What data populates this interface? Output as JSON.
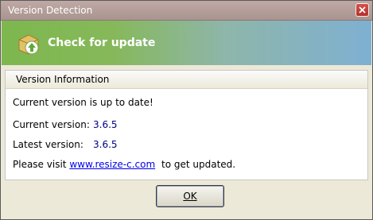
{
  "window": {
    "title": "Version Detection"
  },
  "banner": {
    "title": "Check for update",
    "icon": "package-update-icon"
  },
  "panel": {
    "header": "Version Information",
    "status_text": "Current version is up to date!",
    "current_label": "Current version:",
    "current_value": "3.6.5",
    "latest_label": "Latest version:",
    "latest_value": "3.6.5",
    "visit_prefix": "Please visit",
    "visit_link": "www.resize-c.com",
    "visit_suffix": "to get updated."
  },
  "buttons": {
    "ok_label": "OK"
  },
  "colors": {
    "banner_left": "#7db74e",
    "banner_right": "#7fb0d2",
    "version_value": "#000080",
    "link": "#0000ee"
  }
}
